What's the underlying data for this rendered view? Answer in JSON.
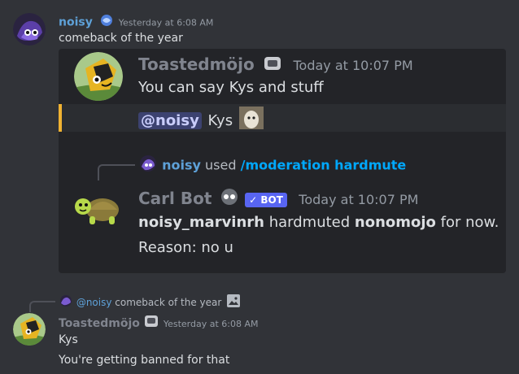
{
  "msg1": {
    "author": "noisy",
    "timestamp": "Yesterday at 6:08 AM",
    "text": "comeback of the year"
  },
  "embed": {
    "author": "Toastedmöjo",
    "timestamp": "Today at 10:07 PM",
    "line1": "You can say Kys and stuff",
    "quote_mention": "@noisy",
    "quote_text": "Kys",
    "command": {
      "user": "noisy",
      "used": "used",
      "name": "/moderation hardmute"
    },
    "bot": {
      "author": "Carl Bot",
      "tag": "BOT",
      "timestamp": "Today at 10:07 PM",
      "actor": "noisy_marvinrh",
      "action": " hardmuted ",
      "target": "nonomojo",
      "duration": " for now.",
      "reason": "Reason: no u"
    }
  },
  "reply": {
    "mention": "@noisy",
    "text": "comeback of the year"
  },
  "msg2": {
    "author": "Toastedmöjo",
    "timestamp": "Yesterday at 6:08 AM",
    "line1": "Kys",
    "line2": "You're getting banned for that"
  },
  "colors": {
    "background": "#313338",
    "embed": "#232428",
    "quote_bar": "#f0b232",
    "bot_tag": "#5865f2",
    "link": "#00a8fc",
    "username": "#5ea1d8"
  }
}
